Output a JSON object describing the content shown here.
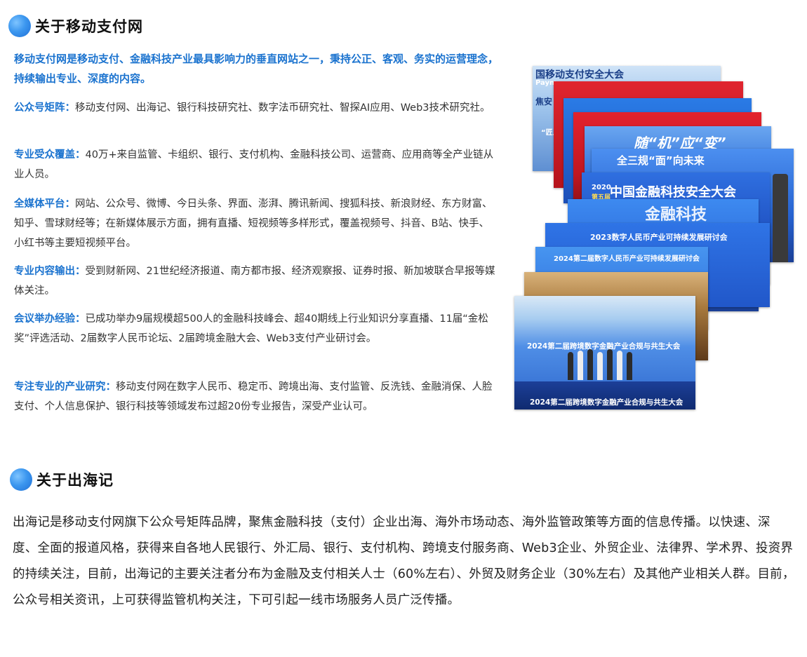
{
  "section1": {
    "title": "关于移动支付网",
    "intro": "移动支付网是移动支付、金融科技产业最具影响力的垂直网站之一，秉持公正、客观、务实的运营理念，持续输出专业、深度的内容。",
    "items": [
      {
        "label": "公众号矩阵：",
        "text": "移动支付网、出海记、银行科技研究社、数字法币研究社、智探AI应用、Web3技术研究社。"
      },
      {
        "label": "专业受众覆盖：",
        "text": "40万+来自监管、卡组织、银行、支付机构、金融科技公司、运营商、应用商等全产业链从业人员。"
      },
      {
        "label": "全媒体平台：",
        "text": "网站、公众号、微博、今日头条、界面、澎湃、腾讯新闻、搜狐科技、新浪财经、东方财富、知乎、雪球财经等；在新媒体展示方面，拥有直播、短视频等多样形式，覆盖视频号、抖音、B站、快手、小红书等主要短视频平台。"
      },
      {
        "label": "专业内容输出：",
        "text": "受到财新网、21世纪经济报道、南方都市报、经济观察报、证券时报、新加坡联合早报等媒体关注。"
      },
      {
        "label": "会议举办经验：",
        "text": "已成功举办9届规模超500人的金融科技峰会、超40期线上行业知识分享直播、11届“金松奖”评选活动、2届数字人民币论坛、2届跨境金融大会、Web3支付产业研讨会。"
      },
      {
        "label": "专注专业的产业研究：",
        "text": "移动支付网在数字人民币、稳定币、跨境出海、支付监管、反洗钱、金融消保、人脸支付、个人信息保护、银行科技等领域发布过超20份专业报告，深受产业认可。"
      }
    ]
  },
  "collage": {
    "captions": {
      "p1": "国移动支付安全大会",
      "p1b": "Paym",
      "p1c": "焦安",
      "p1d": "“匠人",
      "p4": "随“机”应“变”",
      "p5": "全三规“面”向未来",
      "p6a": "2020",
      "p6b": "第五届",
      "p6c": "中国金融科技安全大会",
      "p7": "金融科技",
      "p8": "2023数字人民币产业可持续发展研讨会",
      "p9": "2024第二届数字人民币产业可持续发展研讨会",
      "p11": "2024第二届跨境数字金融产业合规与共生大会",
      "p11b": "2024第二届跨境数字金融产业合规与共生大会"
    },
    "colors": {
      "blue": "#1f5fd0",
      "red": "#d8202c",
      "deep_blue": "#173a9c"
    }
  },
  "section2": {
    "title": "关于出海记",
    "paragraph": "出海记是移动支付网旗下公众号矩阵品牌，聚焦金融科技（支付）企业出海、海外市场动态、海外监管政策等方面的信息传播。以快速、深度、全面的报道风格，获得来自各地人民银行、外汇局、银行、支付机构、跨境支付服务商、Web3企业、外贸企业、法律界、学术界、投资界的持续关注，目前，出海记的主要关注者分布为金融及支付相关人士（60%左右）、外贸及财务企业（30%左右）及其他产业相关人群。目前，公众号相关资讯，上可获得监管机构关注，下可引起一线市场服务人员广泛传播。"
  }
}
